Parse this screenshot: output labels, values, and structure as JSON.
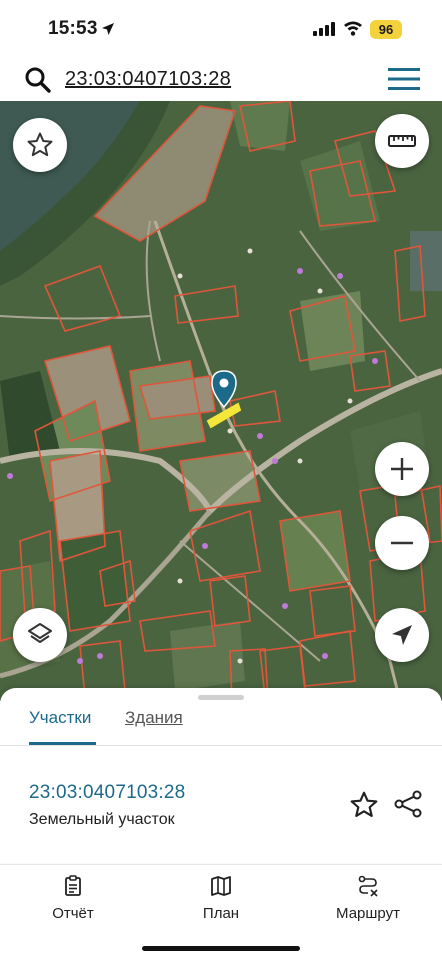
{
  "status_bar": {
    "time": "15:53",
    "battery": "96"
  },
  "search": {
    "query": "23:03:0407103:28"
  },
  "map": {
    "buttons": {
      "favorite": "star-icon",
      "ruler": "ruler-icon",
      "zoom_in": "plus-icon",
      "zoom_out": "minus-icon",
      "layers": "layers-icon",
      "locate": "navigation-arrow-icon"
    },
    "colors": {
      "parcel_outline": "#e0563a",
      "selected_parcel": "#f5e63a",
      "marker": "#1c6a8a"
    }
  },
  "sheet": {
    "tabs": [
      {
        "label": "Участки",
        "active": true
      },
      {
        "label": "Здания",
        "active": false
      }
    ],
    "result": {
      "cadastral_number": "23:03:0407103:28",
      "type": "Земельный участок"
    }
  },
  "bottom_nav": {
    "items": [
      {
        "label": "Отчёт",
        "icon": "clipboard-icon"
      },
      {
        "label": "План",
        "icon": "map-icon"
      },
      {
        "label": "Маршрут",
        "icon": "route-icon"
      }
    ]
  },
  "colors": {
    "accent": "#1c6a8a",
    "battery": "#f4d23b"
  }
}
